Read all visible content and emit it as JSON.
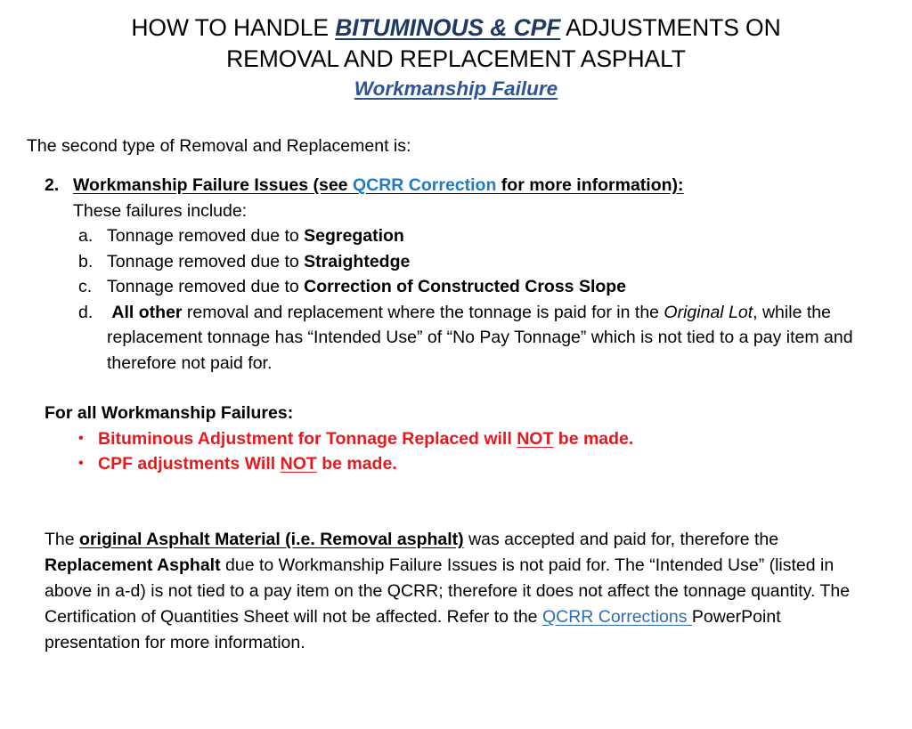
{
  "title": {
    "line1_prefix": "HOW TO HANDLE ",
    "line1_emphasis": "BITUMINOUS & CPF",
    "line1_suffix": " ADJUSTMENTS ON",
    "line2": "REMOVAL AND REPLACEMENT ASPHALT",
    "subtitle": "Workmanship Failure"
  },
  "intro": {
    "text": "The second type of Removal and Replacement is:"
  },
  "item2": {
    "marker": "2.",
    "text_before_link": "Workmanship Failure Issues (see ",
    "link_label": "QCRR Correction",
    "text_after_link": " for more information):",
    "sub_intro": "These failures include:",
    "subitems": [
      {
        "marker": "a.",
        "plain_before": "Tonnage removed due to ",
        "bold": "Segregation",
        "plain_after": ""
      },
      {
        "marker": "b.",
        "plain_before": "Tonnage removed due to ",
        "bold": "Straightedge",
        "plain_after": ""
      },
      {
        "marker": "c.",
        "plain_before": "Tonnage removed due to ",
        "bold": "Correction of Constructed Cross Slope",
        "plain_after": ""
      }
    ],
    "subitem_d": {
      "marker": "d.",
      "bold_lead": "All other",
      "text_mid": " removal and replacement where the tonnage is paid for in the ",
      "italic_term": "Original Lot",
      "text_tail": ", while the replacement tonnage has “Intended Use” of “No Pay Tonnage” which is not tied to a pay item and therefore not paid for."
    }
  },
  "failures_section": {
    "heading": "For all Workmanship Failures:",
    "bullet_glyph": "•",
    "bullets": [
      {
        "before": "Bituminous Adjustment for Tonnage Replaced will ",
        "underlined": "NOT",
        "after": " be made."
      },
      {
        "before": "CPF adjustments Will ",
        "underlined": "NOT",
        "after": " be made."
      }
    ]
  },
  "closing": {
    "p1": "The ",
    "bold_underline": "original Asphalt Material (i.e. Removal asphalt)",
    "p2": " was accepted and paid for, therefore the ",
    "bold2": "Replacement Asphalt",
    "p3": " due to Workmanship Failure Issues is not paid for.  The “Intended Use” (listed in above in a-d) is not tied to a pay item on the QCRR; therefore it does not affect the tonnage quantity. The Certification of Quantities Sheet will not be affected. Refer to the ",
    "link_label": "QCRR Corrections ",
    "p4": "PowerPoint presentation for more information."
  },
  "colors": {
    "title_blue": "#1F3864",
    "subtitle_blue": "#2E5496",
    "link_blue": "#1F7AC9",
    "hyperlink_blue": "#2E6DB4",
    "alert_red": "#E8191E"
  }
}
